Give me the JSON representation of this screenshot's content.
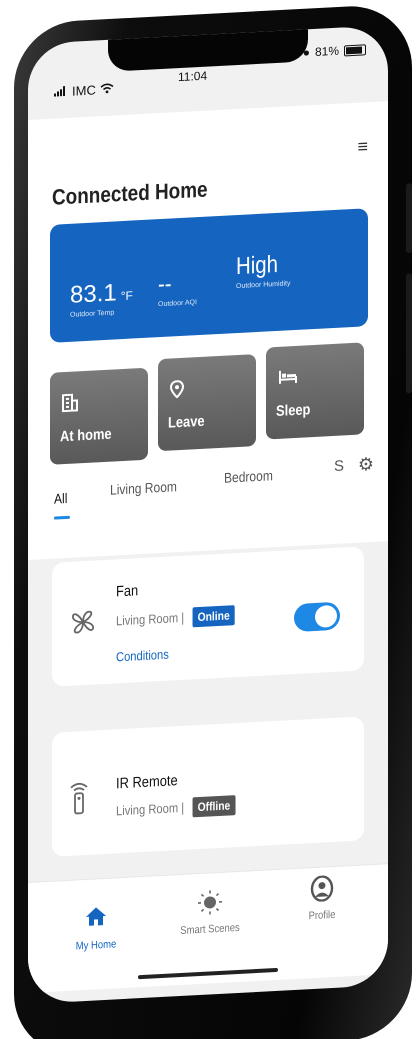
{
  "status_bar": {
    "carrier": "IMC",
    "time": "11:04",
    "battery": "81%"
  },
  "header": {
    "title": "Connected Home",
    "menu_icon": "hamburger-menu-icon"
  },
  "weather": {
    "temp_value": "83.1",
    "temp_unit": "°F",
    "temp_label": "Outdoor Temp",
    "aqi_value": "--",
    "aqi_label": "Outdoor AQI",
    "humidity_value": "High",
    "humidity_label": "Outdoor Humidity",
    "card_color": "#1565c0"
  },
  "scenes": [
    {
      "label": "At home",
      "icon": "building-icon"
    },
    {
      "label": "Leave",
      "icon": "location-pin-icon"
    },
    {
      "label": "Sleep",
      "icon": "bed-icon"
    }
  ],
  "tabs": {
    "items": [
      {
        "label": "All",
        "active": true
      },
      {
        "label": "Living Room",
        "active": false
      },
      {
        "label": "Bedroom",
        "active": false
      }
    ],
    "more_glyph": "S",
    "settings_icon": "gear-icon"
  },
  "devices": [
    {
      "name": "Fan",
      "room": "Living Room",
      "status": "Online",
      "link": "Conditions",
      "icon": "fan-icon",
      "toggle_on": true
    },
    {
      "name": "IR Remote",
      "room": "Living Room",
      "status": "Offline",
      "icon": "ir-remote-icon"
    }
  ],
  "bottom_nav": [
    {
      "label": "My Home",
      "icon": "home-icon",
      "active": true
    },
    {
      "label": "Smart Scenes",
      "icon": "sun-icon",
      "active": false
    },
    {
      "label": "Profile",
      "icon": "profile-icon",
      "active": false
    }
  ],
  "colors": {
    "accent": "#1e88e5",
    "online_badge": "#1565c0",
    "offline_badge": "#555555"
  }
}
